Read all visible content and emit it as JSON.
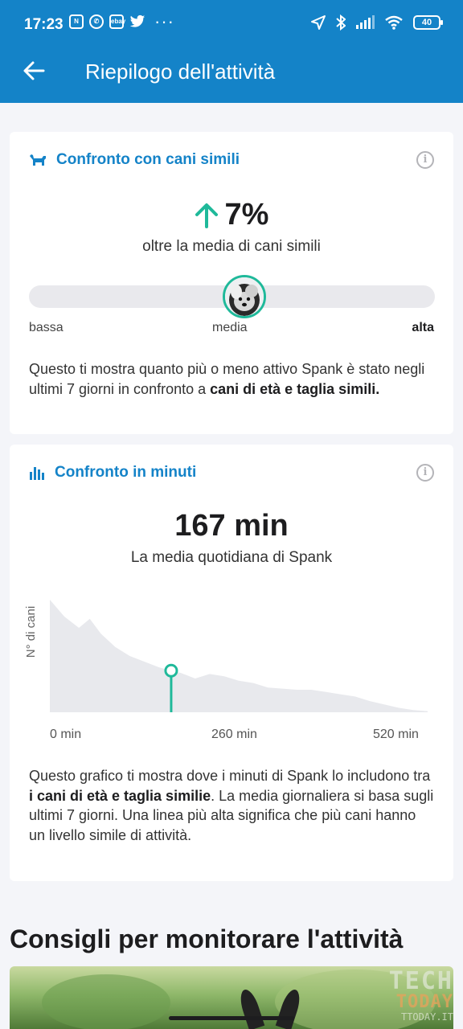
{
  "status_bar": {
    "time": "17:23",
    "left_icons": [
      "nfc-icon",
      "whatsapp-icon",
      "ebay-icon",
      "twitter-icon",
      "more-dots-icon"
    ],
    "right_icons": [
      "location-icon",
      "bluetooth-icon",
      "signal-icon",
      "wifi-icon"
    ],
    "ebay_label": "ebay",
    "more": "···",
    "battery": "40"
  },
  "app_bar": {
    "title": "Riepilogo dell'attività"
  },
  "similar_dogs": {
    "heading": "Confronto con cani simili",
    "percent": "7%",
    "trend": "up",
    "subtitle": "oltre la media di cani simili",
    "scale_low": "bassa",
    "scale_mid": "media",
    "scale_high": "alta",
    "scale_position": 0.53,
    "desc_plain": "Questo ti mostra quanto più o meno attivo Spank è stato negli ultimi 7 giorni in confronto a ",
    "desc_bold": "cani di età e taglia simili."
  },
  "minutes": {
    "heading": "Confronto in minuti",
    "value": "167 min",
    "subtitle": "La media quotidiana di Spank",
    "desc_plain_1": "Questo grafico ti mostra dove i minuti di Spank lo includono tra ",
    "desc_bold": "i cani di età e taglia similie",
    "desc_plain_2": ". La media giornaliera si basa sugli ultimi 7 giorni. Una linea più alta significa che più cani hanno un livello simile di attività."
  },
  "chart_data": {
    "type": "area",
    "ylabel": "N° di cani",
    "xlabel": "",
    "x_ticks": [
      "0 min",
      "260 min",
      "520 min"
    ],
    "xlim": [
      0,
      520
    ],
    "x": [
      0,
      20,
      40,
      55,
      70,
      90,
      110,
      130,
      150,
      167,
      180,
      200,
      220,
      240,
      260,
      280,
      300,
      320,
      340,
      360,
      380,
      400,
      420,
      440,
      460,
      480,
      500,
      520
    ],
    "y": [
      100,
      85,
      75,
      83,
      70,
      58,
      50,
      45,
      40,
      37,
      35,
      30,
      34,
      32,
      28,
      26,
      22,
      21,
      20,
      20,
      18,
      16,
      14,
      10,
      7,
      4,
      2,
      1
    ],
    "marker_x": 167,
    "grid": false,
    "color": "#1fb99a",
    "fill": "#e8e9ed"
  },
  "tips": {
    "heading": "Consigli per monitorare l'attività"
  },
  "watermark": {
    "line1": "TECH",
    "line2": "TODAY",
    "line3": "TTODAY.IT"
  }
}
